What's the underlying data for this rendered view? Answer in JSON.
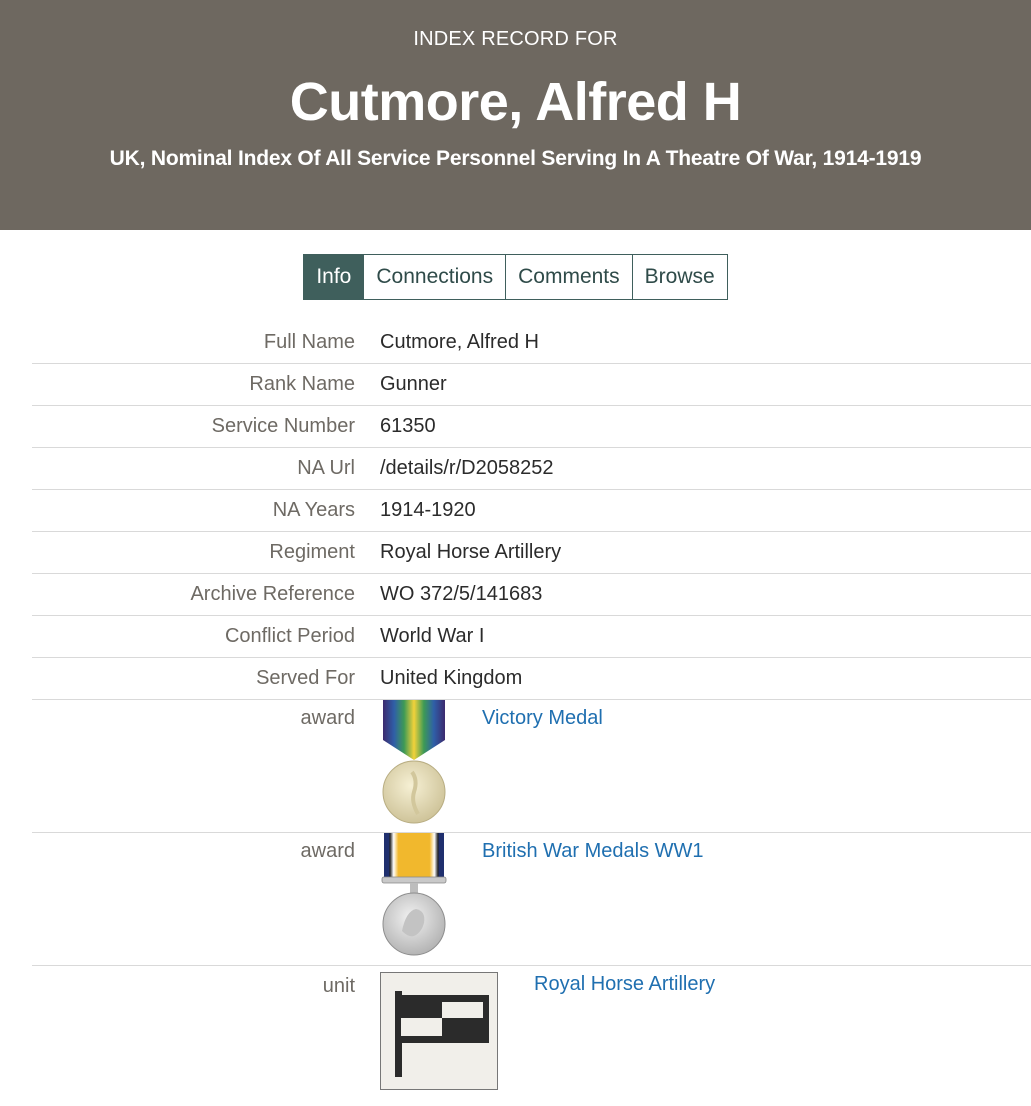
{
  "header": {
    "pretitle": "INDEX RECORD FOR",
    "name": "Cutmore, Alfred H",
    "subtitle": "UK, Nominal Index Of All Service Personnel Serving In A Theatre Of War, 1914-1919"
  },
  "tabs": [
    {
      "label": "Info",
      "active": true
    },
    {
      "label": "Connections",
      "active": false
    },
    {
      "label": "Comments",
      "active": false
    },
    {
      "label": "Browse",
      "active": false
    }
  ],
  "fields": [
    {
      "label": "Full Name",
      "value": "Cutmore, Alfred H"
    },
    {
      "label": "Rank Name",
      "value": "Gunner"
    },
    {
      "label": "Service Number",
      "value": "61350"
    },
    {
      "label": "NA Url",
      "value": "/details/r/D2058252"
    },
    {
      "label": "NA Years",
      "value": "1914-1920"
    },
    {
      "label": "Regiment",
      "value": "Royal Horse Artillery"
    },
    {
      "label": "Archive Reference",
      "value": "WO 372/5/141683"
    },
    {
      "label": "Conflict Period",
      "value": "World War I"
    },
    {
      "label": "Served For",
      "value": "United Kingdom"
    }
  ],
  "awards": [
    {
      "label": "award",
      "link": "Victory Medal",
      "icon": "victory-medal-icon"
    },
    {
      "label": "award",
      "link": "British War Medals WW1",
      "icon": "british-war-medal-icon"
    }
  ],
  "unit": {
    "label": "unit",
    "link": "Royal Horse Artillery",
    "icon": "unit-flag-icon"
  },
  "colors": {
    "header_bg": "#6e6860",
    "tab_active": "#3f5f5c",
    "link": "#1f6fb0"
  }
}
